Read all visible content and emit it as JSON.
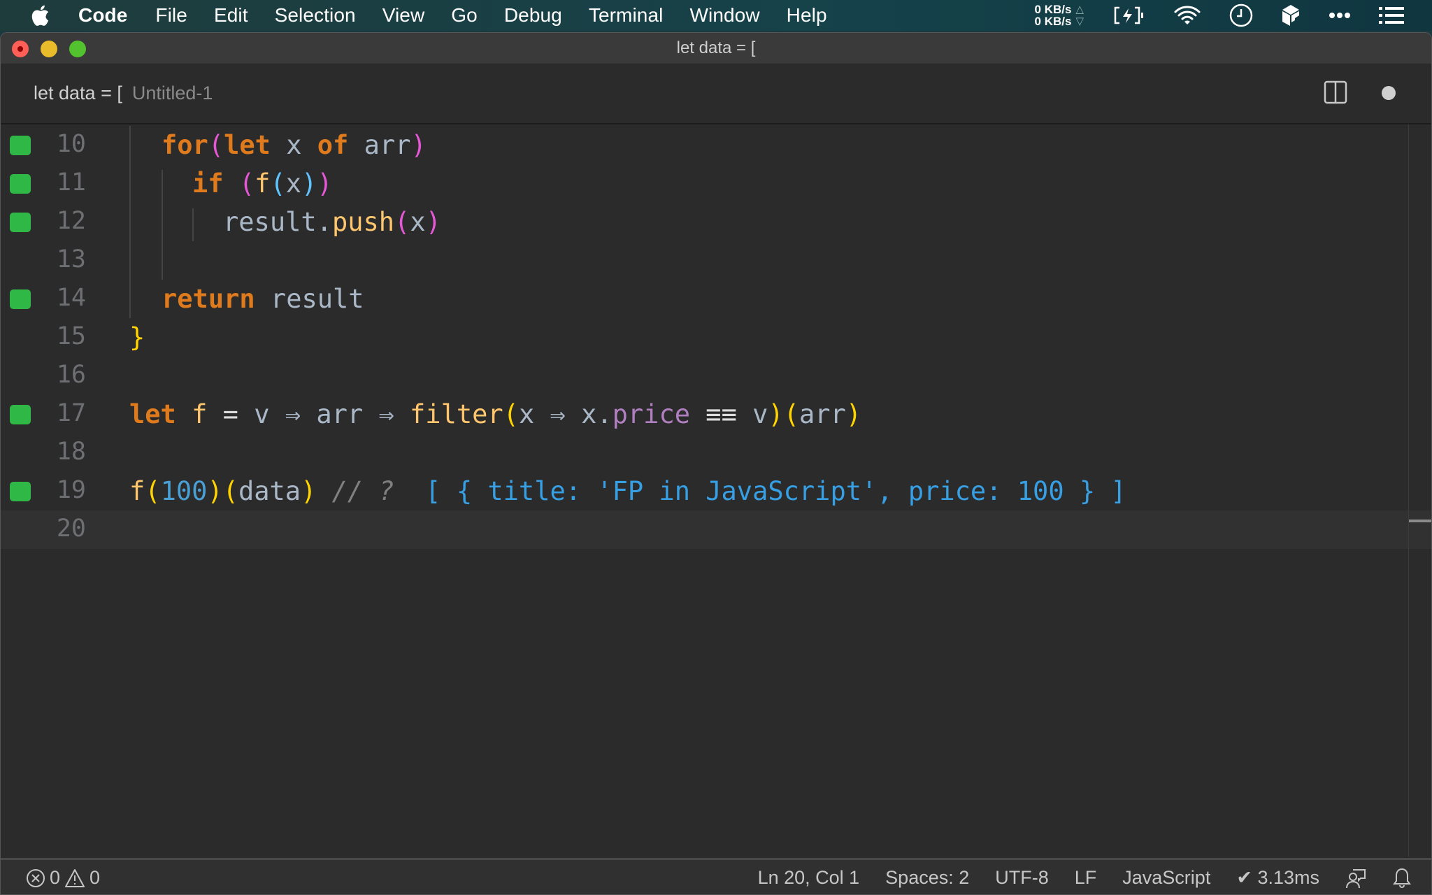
{
  "menubar": {
    "app_name": "Code",
    "items": [
      "File",
      "Edit",
      "Selection",
      "View",
      "Go",
      "Debug",
      "Terminal",
      "Window",
      "Help"
    ],
    "tray": {
      "upload_speed": "0 KB/s",
      "download_speed": "0 KB/s",
      "upload_arrow": "△",
      "download_arrow": "▽",
      "icons": [
        "battery-charging-icon",
        "wifi-icon",
        "clock-icon",
        "app-cube-icon",
        "more-icon",
        "list-icon"
      ]
    }
  },
  "window": {
    "title": "let data = [",
    "tab": {
      "title": "let data = [",
      "description": "Untitled-1",
      "dirty": true
    }
  },
  "editor": {
    "current_line": 20,
    "lines": [
      {
        "number": "10",
        "marker": true,
        "indent": 1,
        "tokens": [
          {
            "t": "for",
            "c": "kw"
          },
          {
            "t": "(",
            "c": "p2"
          },
          {
            "t": "let",
            "c": "kw"
          },
          {
            "t": " x ",
            "c": "id"
          },
          {
            "t": "of",
            "c": "kw"
          },
          {
            "t": " arr",
            "c": "id"
          },
          {
            "t": ")",
            "c": "p2"
          }
        ]
      },
      {
        "number": "11",
        "marker": true,
        "indent": 2,
        "tokens": [
          {
            "t": "if",
            "c": "kw"
          },
          {
            "t": " ",
            "c": "id"
          },
          {
            "t": "(",
            "c": "p2"
          },
          {
            "t": "f",
            "c": "fn"
          },
          {
            "t": "(",
            "c": "p3"
          },
          {
            "t": "x",
            "c": "id"
          },
          {
            "t": ")",
            "c": "p3"
          },
          {
            "t": ")",
            "c": "p2"
          }
        ]
      },
      {
        "number": "12",
        "marker": true,
        "indent": 3,
        "tokens": [
          {
            "t": "result.",
            "c": "id"
          },
          {
            "t": "push",
            "c": "fn"
          },
          {
            "t": "(",
            "c": "p2"
          },
          {
            "t": "x",
            "c": "id"
          },
          {
            "t": ")",
            "c": "p2"
          }
        ]
      },
      {
        "number": "13",
        "marker": false,
        "indent": 0,
        "tokens": []
      },
      {
        "number": "14",
        "marker": true,
        "indent": 1,
        "tokens": [
          {
            "t": "return",
            "c": "kw"
          },
          {
            "t": " result",
            "c": "id"
          }
        ]
      },
      {
        "number": "15",
        "marker": false,
        "indent": 0,
        "tokens": [
          {
            "t": "}",
            "c": "p1"
          }
        ]
      },
      {
        "number": "16",
        "marker": false,
        "indent": 0,
        "tokens": []
      },
      {
        "number": "17",
        "marker": true,
        "indent": 0,
        "tokens": [
          {
            "t": "let",
            "c": "kw"
          },
          {
            "t": " ",
            "c": "id"
          },
          {
            "t": "f",
            "c": "fn"
          },
          {
            "t": " = ",
            "c": "op"
          },
          {
            "t": "v ",
            "c": "id"
          },
          {
            "t": "⇒",
            "c": "id"
          },
          {
            "t": " arr ",
            "c": "id"
          },
          {
            "t": "⇒",
            "c": "id"
          },
          {
            "t": " ",
            "c": "id"
          },
          {
            "t": "filter",
            "c": "fn"
          },
          {
            "t": "(",
            "c": "p1"
          },
          {
            "t": "x ",
            "c": "id"
          },
          {
            "t": "⇒",
            "c": "id"
          },
          {
            "t": " x.",
            "c": "id"
          },
          {
            "t": "price",
            "c": "prop"
          },
          {
            "t": " ≡≡ ",
            "c": "op"
          },
          {
            "t": "v",
            "c": "id"
          },
          {
            "t": ")",
            "c": "p1"
          },
          {
            "t": "(",
            "c": "p1"
          },
          {
            "t": "arr",
            "c": "id"
          },
          {
            "t": ")",
            "c": "p1"
          }
        ]
      },
      {
        "number": "18",
        "marker": false,
        "indent": 0,
        "tokens": []
      },
      {
        "number": "19",
        "marker": true,
        "indent": 0,
        "tokens": [
          {
            "t": "f",
            "c": "fn"
          },
          {
            "t": "(",
            "c": "p1"
          },
          {
            "t": "100",
            "c": "num"
          },
          {
            "t": ")",
            "c": "p1"
          },
          {
            "t": "(",
            "c": "p1"
          },
          {
            "t": "data",
            "c": "id"
          },
          {
            "t": ")",
            "c": "p1"
          },
          {
            "t": " // ?  ",
            "c": "cmt"
          },
          {
            "t": "[ { title: 'FP in JavaScript', price: 100 } ]",
            "c": "res"
          }
        ]
      },
      {
        "number": "20",
        "marker": false,
        "indent": 0,
        "tokens": []
      }
    ]
  },
  "statusbar": {
    "errors": "0",
    "warnings": "0",
    "position": "Ln 20, Col 1",
    "indentation": "Spaces: 2",
    "encoding": "UTF-8",
    "eol": "LF",
    "language": "JavaScript",
    "quokka_time": "✔ 3.13ms"
  }
}
